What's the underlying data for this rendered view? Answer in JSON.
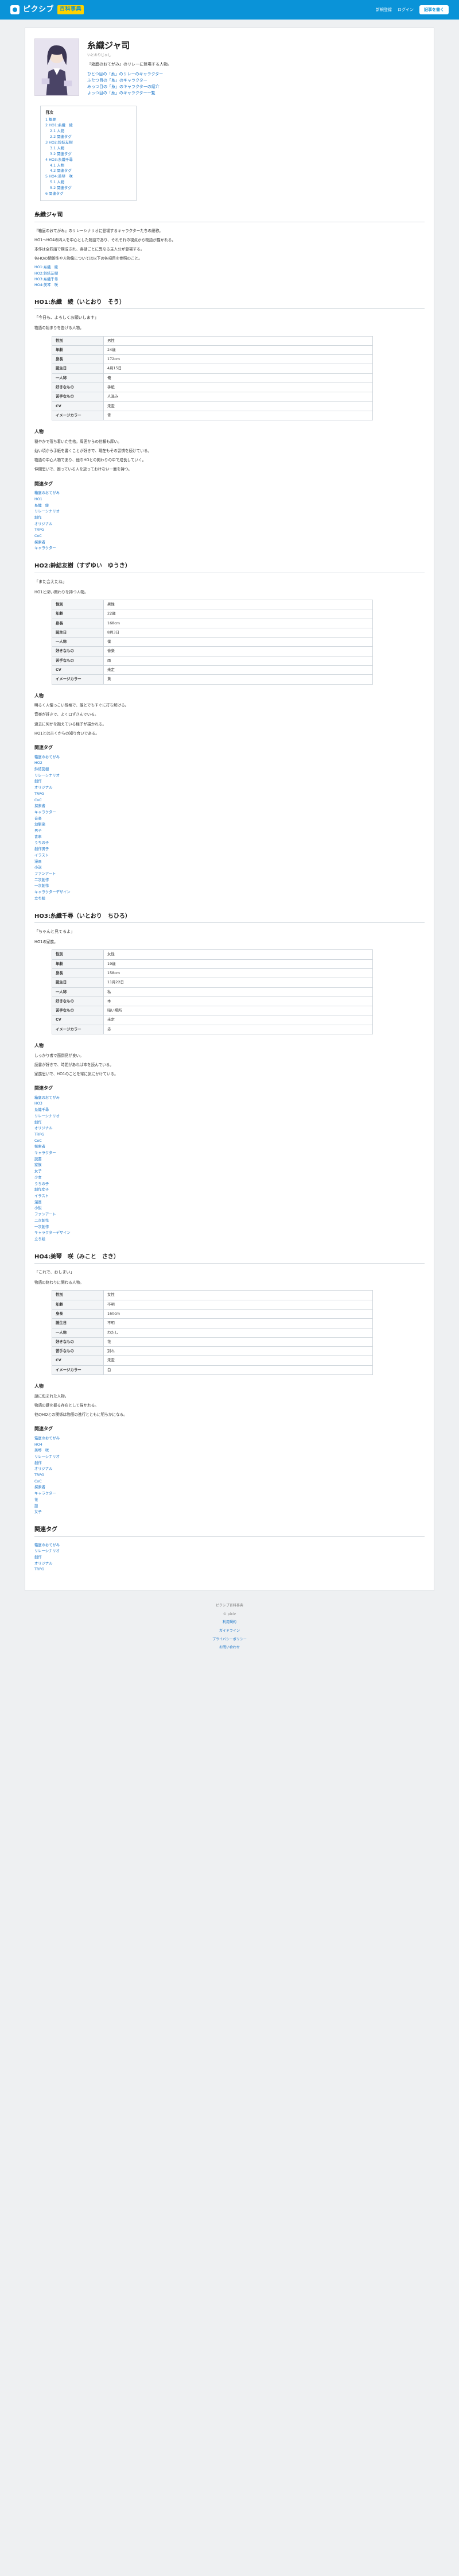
{
  "header": {
    "logo": "ピクシブ",
    "logo_sub": "百科事典",
    "nav": [
      "新規登録",
      "ログイン",
      "記事を書く"
    ]
  },
  "article": {
    "title": "糸織ジャ司",
    "reading": "いとおりじゃし",
    "lead": "『箱庭のおてがみ』のリレーに登場する人物。",
    "links": [
      "ひとつ目の「糸」のリレーのキャラクター",
      "ふたつ目の「糸」のキャラクター",
      "みっつ目の「糸」のキャラクターの紹介",
      "よっつ目の「糸」のキャラクター一覧"
    ]
  },
  "toc": {
    "title": "目次",
    "items": [
      {
        "t": "1 概要",
        "l": 1
      },
      {
        "t": "2 HO1:糸織　綾",
        "l": 1
      },
      {
        "t": "2.1 人物",
        "l": 2
      },
      {
        "t": "2.2 関連タグ",
        "l": 2
      },
      {
        "t": "3 HO2:鈴結友樹",
        "l": 1
      },
      {
        "t": "3.1 人物",
        "l": 2
      },
      {
        "t": "3.2 関連タグ",
        "l": 2
      },
      {
        "t": "4 HO3:糸織千尋",
        "l": 1
      },
      {
        "t": "4.1 人物",
        "l": 2
      },
      {
        "t": "4.2 関連タグ",
        "l": 2
      },
      {
        "t": "5 HO4:美琴　咲",
        "l": 1
      },
      {
        "t": "5.1 人物",
        "l": 2
      },
      {
        "t": "5.2 関連タグ",
        "l": 2
      },
      {
        "t": "6 関連タグ",
        "l": 1
      }
    ]
  },
  "overview": {
    "heading": "糸織ジャ司",
    "paras": [
      "『箱庭のおてがみ』のリレーシナリオに登場するキャラクターたちの総称。",
      "HO1〜HO4の四人を中心とした物語であり、それぞれの視点から物語が描かれる。",
      "本作は全四話で構成され、各話ごとに異なる主人公が登場する。",
      "各HOの関係性や人物像については以下の各項目を参照のこと。"
    ],
    "links": [
      "HO1:糸織　綾",
      "HO2:鈴結友樹",
      "HO3:糸織千尋",
      "HO4:美琴　咲"
    ]
  },
  "sections": [
    {
      "heading": "HO1:糸織　綾（いとおり　そう）",
      "quote": "「今日も、よろしくお願いします」",
      "intro": "物語の始まりを告げる人物。",
      "table": [
        [
          "性別",
          "男性"
        ],
        [
          "年齢",
          "24歳"
        ],
        [
          "身長",
          "172cm"
        ],
        [
          "誕生日",
          "4月15日"
        ],
        [
          "一人称",
          "俺"
        ],
        [
          "好きなもの",
          "手紙"
        ],
        [
          "苦手なもの",
          "人混み"
        ],
        [
          "CV",
          "未定"
        ],
        [
          "イメージカラー",
          "青"
        ]
      ],
      "person": [
        "穏やかで落ち着いた性格。周囲からの信頼も厚い。",
        "幼い頃から手紙を書くことが好きで、現在もその習慣を続けている。",
        "物語の中心人物であり、他のHOとの関わりの中で成長していく。",
        "仲間思いで、困っている人を放っておけない一面を持つ。"
      ],
      "tags": [
        "箱庭のおてがみ",
        "HO1",
        "糸織　綾",
        "リレーシナリオ",
        "創作",
        "オリジナル",
        "TRPG",
        "CoC",
        "探索者",
        "キャラクター"
      ]
    },
    {
      "heading": "HO2:鈴結友樹（すずゆい　ゆうき）",
      "quote": "「また会えたね」",
      "intro": "HO1と深い関わりを持つ人物。",
      "table": [
        [
          "性別",
          "男性"
        ],
        [
          "年齢",
          "22歳"
        ],
        [
          "身長",
          "168cm"
        ],
        [
          "誕生日",
          "8月3日"
        ],
        [
          "一人称",
          "僕"
        ],
        [
          "好きなもの",
          "音楽"
        ],
        [
          "苦手なもの",
          "雨"
        ],
        [
          "CV",
          "未定"
        ],
        [
          "イメージカラー",
          "黄"
        ]
      ],
      "person": [
        "明るく人懐っこい性格で、誰とでもすぐに打ち解ける。",
        "音楽が好きで、よく口ずさんでいる。",
        "過去に何かを抱えている様子が描かれる。",
        "HO1とは古くからの知り合いである。"
      ],
      "tags": [
        "箱庭のおてがみ",
        "HO2",
        "鈴結友樹",
        "リレーシナリオ",
        "創作",
        "オリジナル",
        "TRPG",
        "CoC",
        "探索者",
        "キャラクター",
        "音楽",
        "幼馴染",
        "男子",
        "青年",
        "うちの子",
        "創作男子",
        "イラスト",
        "漫画",
        "小説",
        "ファンアート",
        "二次創作",
        "一次創作",
        "キャラクターデザイン",
        "立ち絵"
      ]
    },
    {
      "heading": "HO3:糸織千尋（いとおり　ちひろ）",
      "quote": "「ちゃんと見てるよ」",
      "intro": "HO1の家族。",
      "table": [
        [
          "性別",
          "女性"
        ],
        [
          "年齢",
          "19歳"
        ],
        [
          "身長",
          "158cm"
        ],
        [
          "誕生日",
          "11月22日"
        ],
        [
          "一人称",
          "私"
        ],
        [
          "好きなもの",
          "本"
        ],
        [
          "苦手なもの",
          "暗い場所"
        ],
        [
          "CV",
          "未定"
        ],
        [
          "イメージカラー",
          "赤"
        ]
      ],
      "person": [
        "しっかり者で面倒見が良い。",
        "読書が好きで、時間があれば本を読んでいる。",
        "家族思いで、HO1のことを常に気にかけている。"
      ],
      "tags": [
        "箱庭のおてがみ",
        "HO3",
        "糸織千尋",
        "リレーシナリオ",
        "創作",
        "オリジナル",
        "TRPG",
        "CoC",
        "探索者",
        "キャラクター",
        "読書",
        "家族",
        "女子",
        "少女",
        "うちの子",
        "創作女子",
        "イラスト",
        "漫画",
        "小説",
        "ファンアート",
        "二次創作",
        "一次創作",
        "キャラクターデザイン",
        "立ち絵"
      ]
    },
    {
      "heading": "HO4:美琴　咲（みこと　さき）",
      "quote": "「これで、おしまい」",
      "intro": "物語の終わりに関わる人物。",
      "table": [
        [
          "性別",
          "女性"
        ],
        [
          "年齢",
          "不明"
        ],
        [
          "身長",
          "160cm"
        ],
        [
          "誕生日",
          "不明"
        ],
        [
          "一人称",
          "わたし"
        ],
        [
          "好きなもの",
          "花"
        ],
        [
          "苦手なもの",
          "別れ"
        ],
        [
          "CV",
          "未定"
        ],
        [
          "イメージカラー",
          "白"
        ]
      ],
      "person": [
        "謎に包まれた人物。",
        "物語の鍵を握る存在として描かれる。",
        "他のHOとの関係は物語の進行とともに明らかになる。"
      ],
      "tags": [
        "箱庭のおてがみ",
        "HO4",
        "美琴　咲",
        "リレーシナリオ",
        "創作",
        "オリジナル",
        "TRPG",
        "CoC",
        "探索者",
        "キャラクター",
        "花",
        "謎",
        "女子"
      ]
    }
  ],
  "labels": {
    "person": "人物",
    "tags": "関連タグ"
  },
  "related": {
    "heading": "関連タグ",
    "tags": [
      "箱庭のおてがみ",
      "リレーシナリオ",
      "創作",
      "オリジナル",
      "TRPG"
    ]
  },
  "footer": {
    "lines": [
      "ピクシブ百科事典",
      "© pixiv",
      "利用規約",
      "ガイドライン",
      "プライバシーポリシー",
      "お問い合わせ"
    ]
  }
}
